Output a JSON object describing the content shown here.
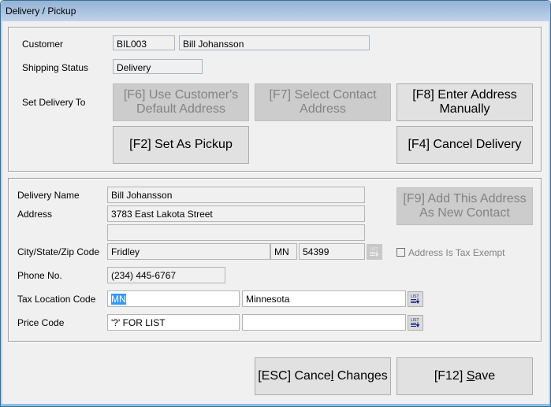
{
  "window": {
    "title": "Delivery / Pickup"
  },
  "customer_section": {
    "customer_label": "Customer",
    "customer_code": "BIL003",
    "customer_name": "Bill Johansson",
    "shipping_status_label": "Shipping Status",
    "shipping_status": "Delivery",
    "set_delivery_to_label": "Set Delivery To",
    "buttons": {
      "default_address": {
        "line1": "[F6] Use Customer's",
        "line2": "Default Address",
        "enabled": false
      },
      "select_contact": {
        "line1": "[F7] Select Contact",
        "line2": "Address",
        "enabled": false
      },
      "enter_manually": {
        "line1": "[F8] Enter Address",
        "line2": "Manually",
        "enabled": true
      },
      "set_pickup": {
        "label": "[F2] Set As Pickup",
        "enabled": true
      },
      "cancel_delivery": {
        "label": "[F4] Cancel Delivery",
        "enabled": true
      }
    }
  },
  "address_section": {
    "delivery_name_label": "Delivery Name",
    "delivery_name": "Bill Johansson",
    "address_label": "Address",
    "address_line1": "3783 East Lakota Street",
    "address_line2": "",
    "city_state_zip_label": "City/State/Zip Code",
    "city": "Fridley",
    "state": "MN",
    "zip": "54399",
    "list_icon_text": "LIST",
    "tax_exempt_label": "Address Is Tax Exempt",
    "tax_exempt_checked": false,
    "phone_label": "Phone No.",
    "phone": "(234) 445-6767",
    "tax_location_label": "Tax Location Code",
    "tax_location_code": "MN",
    "tax_location_name": "Minnesota",
    "price_code_label": "Price Code",
    "price_code": "'?' FOR LIST",
    "price_code_name": "",
    "add_contact_button": {
      "line1": "[F9] Add This Address",
      "line2": "As New Contact",
      "enabled": false
    }
  },
  "footer": {
    "cancel_changes": {
      "prefix": "[ESC] Cance",
      "mnemonic": "l",
      "suffix": " Changes"
    },
    "save": {
      "prefix": "[F12] ",
      "mnemonic": "S",
      "suffix": "ave"
    }
  }
}
